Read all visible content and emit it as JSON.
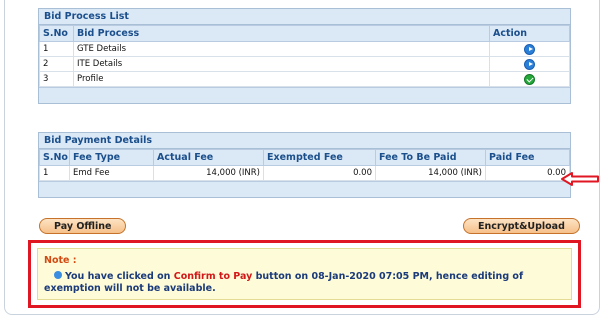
{
  "bid_process": {
    "title": "Bid Process List",
    "headers": {
      "sno": "S.No",
      "process": "Bid Process",
      "action": "Action"
    },
    "rows": [
      {
        "sno": "1",
        "process": "GTE Details",
        "action_icon": "play-circle-icon"
      },
      {
        "sno": "2",
        "process": "ITE Details",
        "action_icon": "play-circle-icon"
      },
      {
        "sno": "3",
        "process": "Profile",
        "action_icon": "check-circle-icon"
      }
    ]
  },
  "bid_payment": {
    "title": "Bid Payment Details",
    "headers": {
      "sno": "S.No",
      "fee_type": "Fee Type",
      "actual_fee": "Actual Fee",
      "exempted_fee": "Exempted Fee",
      "fee_to_be_paid": "Fee To Be Paid",
      "paid_fee": "Paid Fee"
    },
    "rows": [
      {
        "sno": "1",
        "fee_type": "Emd Fee",
        "actual_fee": "14,000 (INR)",
        "exempted_fee": "0.00",
        "fee_to_be_paid": "14,000 (INR)",
        "paid_fee": "0.00"
      }
    ]
  },
  "buttons": {
    "pay_offline": "Pay Offline",
    "encrypt_upload": "Encrypt&Upload"
  },
  "note": {
    "label": "Note :",
    "text_before": "You have clicked on ",
    "highlight": "Confirm to Pay",
    "text_after": " button on 08-Jan-2020 07:05 PM, hence editing of exemption will not be available."
  },
  "colors": {
    "accent": "#1b4f8c",
    "header_bg": "#dbe9f7",
    "annotation_red": "#e01622",
    "note_bg": "#fdfbd8",
    "button_orange": "#f6c08a"
  }
}
